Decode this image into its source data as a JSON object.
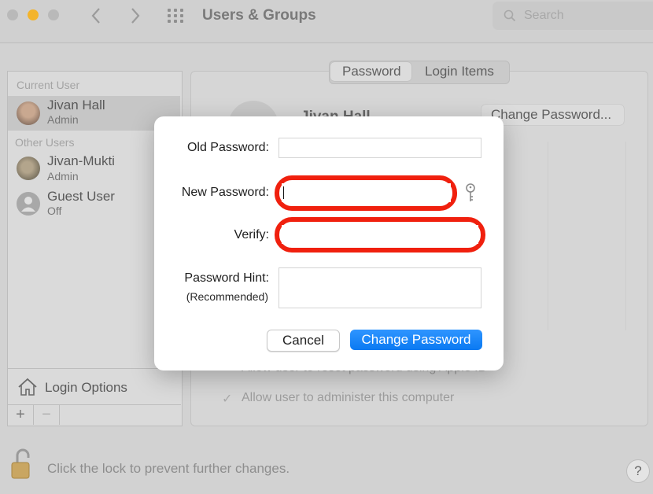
{
  "window": {
    "title": "Users & Groups",
    "search_placeholder": "Search"
  },
  "sidebar": {
    "current_user_header": "Current User",
    "other_users_header": "Other Users",
    "current_user": {
      "name": "Jivan Hall",
      "role": "Admin"
    },
    "other_users": [
      {
        "name": "Jivan-Mukti",
        "role": "Admin"
      },
      {
        "name": "Guest User",
        "role": "Off"
      }
    ],
    "login_options": "Login Options"
  },
  "main": {
    "tabs": [
      {
        "label": "Password",
        "active": true
      },
      {
        "label": "Login Items",
        "active": false
      }
    ],
    "profile_name": "Jivan Hall",
    "change_password_button": "Change Password...",
    "reset_option": "Allow user to reset password using Apple ID",
    "admin_option": "Allow user to administer this computer"
  },
  "footer": {
    "lock_text": "Click the lock to prevent further changes.",
    "help": "?"
  },
  "dialog": {
    "old_password_label": "Old Password:",
    "new_password_label": "New Password:",
    "verify_label": "Verify:",
    "hint_label": "Password Hint:",
    "hint_sublabel": "(Recommended)",
    "cancel_button": "Cancel",
    "confirm_button": "Change Password"
  },
  "colors": {
    "highlight_ring": "#f0200e",
    "primary_button": "#0a79f2"
  }
}
